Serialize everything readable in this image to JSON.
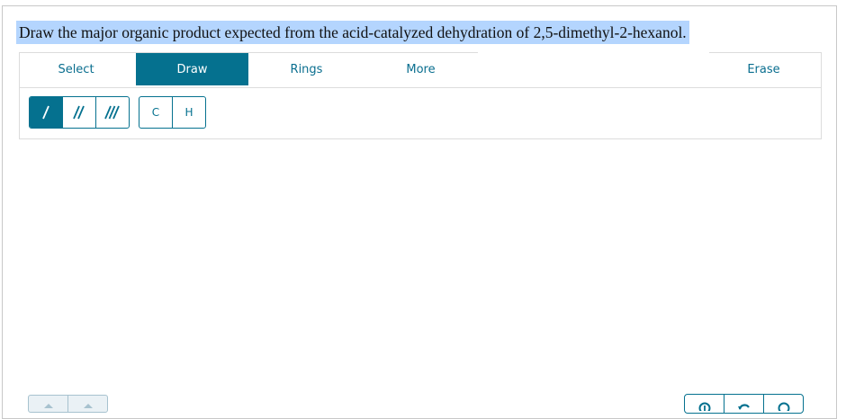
{
  "question": {
    "text": "Draw the major organic product expected from the acid-catalyzed dehydration of 2,5-dimethyl-2-hexanol."
  },
  "tabs": [
    {
      "label": "Select",
      "active": false
    },
    {
      "label": "Draw",
      "active": true
    },
    {
      "label": "Rings",
      "active": false
    },
    {
      "label": "More",
      "active": false
    },
    {
      "label": "Erase",
      "active": false
    }
  ],
  "bond_tools": [
    {
      "name": "single-bond-icon",
      "selected": true
    },
    {
      "name": "double-bond-icon",
      "selected": false
    },
    {
      "name": "triple-bond-icon",
      "selected": false
    }
  ],
  "atom_tools": [
    {
      "label": "C"
    },
    {
      "label": "H"
    }
  ],
  "bottom_controls": {
    "left": [
      "undo-arrow-icon",
      "redo-arrow-icon"
    ],
    "right": [
      "zoom-in-icon",
      "reset-icon",
      "zoom-out-icon"
    ]
  },
  "colors": {
    "accent": "#05718f",
    "selection_highlight": "#b4d5fe"
  }
}
